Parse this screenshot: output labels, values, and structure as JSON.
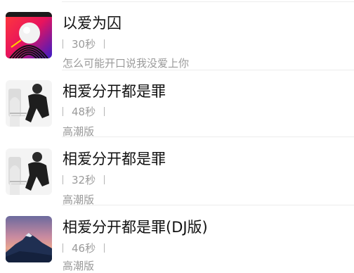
{
  "songs": [
    {
      "title": "以爱为囚",
      "duration": "30秒",
      "subtitle": "怎么可能开口说我没爱上你",
      "cover": "cover-yiaiweiqiu",
      "cover_label": "YIAIWEIQIU"
    },
    {
      "title": "相爱分开都是罪",
      "duration": "48秒",
      "subtitle": "高潮版",
      "cover": "cover-xiangai-portrait"
    },
    {
      "title": "相爱分开都是罪",
      "duration": "32秒",
      "subtitle": "高潮版",
      "cover": "cover-xiangai-portrait"
    },
    {
      "title": "相爱分开都是罪(DJ版)",
      "duration": "46秒",
      "subtitle": "高潮版",
      "cover": "cover-mountain-sunset"
    }
  ]
}
